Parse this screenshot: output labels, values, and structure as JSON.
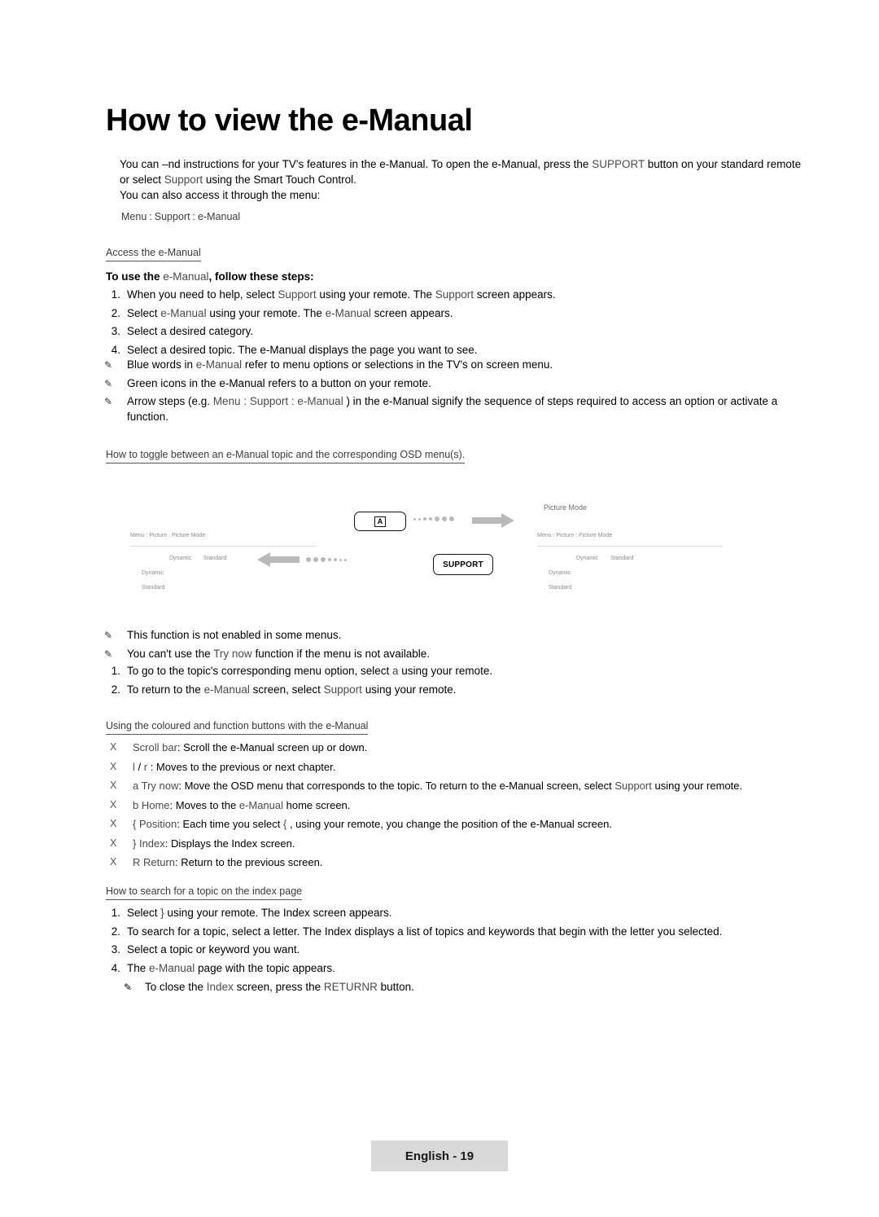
{
  "title": "How to view the e-Manual",
  "intro": {
    "p1_a": "You can ",
    "p1_b": "–nd instructions for your TV's features in the e-Manual. To open the e-Manual, press the ",
    "p1_support": "SUPPORT",
    "p1_c": " button on your standard remote or select ",
    "p1_support2": "Support",
    "p1_d": " using the Smart Touch Control.",
    "p2": "You can also access it through the menu:",
    "menu_path": [
      "Menu",
      "Support",
      "e-Manual"
    ]
  },
  "sections": {
    "access": {
      "heading_a": "Access the",
      "heading_b": "e-Manual",
      "lead_a": "To use the ",
      "lead_b": "e-Manual",
      "lead_c": ", follow these steps:",
      "steps": [
        {
          "num": "1.",
          "parts": [
            {
              "t": "When you need to help, select ",
              "s": "n"
            },
            {
              "t": "Support",
              "s": "l"
            },
            {
              "t": " using your remote. The ",
              "s": "n"
            },
            {
              "t": "Support",
              "s": "l"
            },
            {
              "t": " screen appears.",
              "s": "n"
            }
          ]
        },
        {
          "num": "2.",
          "parts": [
            {
              "t": "Select ",
              "s": "n"
            },
            {
              "t": "e-Manual",
              "s": "l"
            },
            {
              "t": " using your remote. The ",
              "s": "n"
            },
            {
              "t": "e-Manual",
              "s": "l"
            },
            {
              "t": " screen appears.",
              "s": "n"
            }
          ]
        },
        {
          "num": "3.",
          "parts": [
            {
              "t": "Select a desired category.",
              "s": "n"
            }
          ]
        },
        {
          "num": "4.",
          "parts": [
            {
              "t": "Select a desired topic. The e-Manual displays the page you want to see.",
              "s": "n"
            }
          ]
        }
      ],
      "notes": [
        [
          {
            "t": "Blue words in ",
            "s": "n"
          },
          {
            "t": "e-Manual",
            "s": "l"
          },
          {
            "t": " refer to menu options or selections in the TV's on screen menu.",
            "s": "n"
          }
        ],
        [
          {
            "t": "Green icons in the e-Manual refers to a button on your remote.",
            "s": "n"
          }
        ],
        [
          {
            "t": "Arrow steps (e.g. ",
            "s": "n"
          },
          {
            "t": "Menu",
            "s": "l"
          },
          {
            "t": " : ",
            "s": "a"
          },
          {
            "t": "Support",
            "s": "l"
          },
          {
            "t": " : ",
            "s": "a"
          },
          {
            "t": "e-Manual",
            "s": "l"
          },
          {
            "t": " ) in the e-Manual signify the sequence of steps required to access an option or activate a function.",
            "s": "n"
          }
        ]
      ]
    },
    "toggle": {
      "heading": "How to toggle between an e-Manual topic and the corresponding OSD menu(s).",
      "notes": [
        [
          {
            "t": "This function is not enabled in some menus.",
            "s": "n"
          }
        ],
        [
          {
            "t": "You can't use the ",
            "s": "n"
          },
          {
            "t": "Try now",
            "s": "l"
          },
          {
            "t": " function if the menu is not available.",
            "s": "n"
          }
        ]
      ],
      "steps": [
        {
          "num": "1.",
          "parts": [
            {
              "t": "To go to the topic's corresponding menu option, select ",
              "s": "n"
            },
            {
              "t": "a",
              "s": "l"
            },
            {
              "t": " using your remote.",
              "s": "n"
            }
          ]
        },
        {
          "num": "2.",
          "parts": [
            {
              "t": "To return to the ",
              "s": "n"
            },
            {
              "t": "e-Manual",
              "s": "l"
            },
            {
              "t": " screen, select ",
              "s": "n"
            },
            {
              "t": "Support",
              "s": "l"
            },
            {
              "t": " using your remote.",
              "s": "n"
            }
          ]
        }
      ]
    },
    "buttons": {
      "heading": "Using the coloured and function buttons with the e-Manual",
      "items": [
        {
          "bullet": "X",
          "parts": [
            {
              "t": "Scroll bar",
              "s": "l"
            },
            {
              "t": ": Scroll the e-Manual screen up or down.",
              "s": "n"
            }
          ]
        },
        {
          "bullet": "X",
          "parts": [
            {
              "t": "l",
              "s": "l"
            },
            {
              "t": " / ",
              "s": "n"
            },
            {
              "t": "r",
              "s": "l"
            },
            {
              "t": " : Moves to the previous or next chapter.",
              "s": "n"
            }
          ]
        },
        {
          "bullet": "X",
          "parts": [
            {
              "t": "a",
              "s": "l"
            },
            {
              "t": " ",
              "s": "n"
            },
            {
              "t": "Try now",
              "s": "l"
            },
            {
              "t": ": Move the OSD menu that corresponds to the topic. To return to the e-Manual screen, select ",
              "s": "n"
            },
            {
              "t": "Support",
              "s": "l"
            },
            {
              "t": " using your remote.",
              "s": "n"
            }
          ]
        },
        {
          "bullet": "X",
          "parts": [
            {
              "t": "b",
              "s": "l"
            },
            {
              "t": " ",
              "s": "n"
            },
            {
              "t": "Home",
              "s": "l"
            },
            {
              "t": ": Moves to the ",
              "s": "n"
            },
            {
              "t": "e-Manual",
              "s": "l"
            },
            {
              "t": " home screen.",
              "s": "n"
            }
          ]
        },
        {
          "bullet": "X",
          "parts": [
            {
              "t": "{",
              "s": "l"
            },
            {
              "t": " ",
              "s": "n"
            },
            {
              "t": "Position",
              "s": "l"
            },
            {
              "t": ": Each time you select ",
              "s": "n"
            },
            {
              "t": "{",
              "s": "l"
            },
            {
              "t": " , using your remote, you change the position of the e-Manual screen.",
              "s": "n"
            }
          ]
        },
        {
          "bullet": "X",
          "parts": [
            {
              "t": "}",
              "s": "l"
            },
            {
              "t": " ",
              "s": "n"
            },
            {
              "t": "Index",
              "s": "l"
            },
            {
              "t": ": Displays the Index screen.",
              "s": "n"
            }
          ]
        },
        {
          "bullet": "X",
          "parts": [
            {
              "t": "R",
              "s": "l"
            },
            {
              "t": " ",
              "s": "n"
            },
            {
              "t": "Return",
              "s": "l"
            },
            {
              "t": ": Return to the previous screen.",
              "s": "n"
            }
          ]
        }
      ]
    },
    "search": {
      "heading": "How to search for a topic on the index page",
      "steps": [
        {
          "num": "1.",
          "parts": [
            {
              "t": "Select ",
              "s": "n"
            },
            {
              "t": "}",
              "s": "l"
            },
            {
              "t": " using your remote. The Index screen appears.",
              "s": "n"
            }
          ]
        },
        {
          "num": "2.",
          "parts": [
            {
              "t": "To search for a topic, select a letter. The Index displays a list of topics and keywords that begin with the letter you selected.",
              "s": "n"
            }
          ]
        },
        {
          "num": "3.",
          "parts": [
            {
              "t": "Select a topic or keyword you want.",
              "s": "n"
            }
          ]
        },
        {
          "num": "4.",
          "parts": [
            {
              "t": "The ",
              "s": "n"
            },
            {
              "t": "e-Manual",
              "s": "l"
            },
            {
              "t": " page with the topic appears.",
              "s": "n"
            }
          ]
        }
      ],
      "sub_note": [
        {
          "t": "To close the ",
          "s": "n"
        },
        {
          "t": "Index",
          "s": "l"
        },
        {
          "t": " screen, press the ",
          "s": "n"
        },
        {
          "t": "RETURN",
          "s": "l"
        },
        {
          "t": "R",
          "s": "l"
        },
        {
          "t": " button.",
          "s": "n"
        }
      ]
    }
  },
  "diagram": {
    "chip_a_label": "A",
    "chip_support_label": "SUPPORT",
    "picture_mode_label": "Picture Mode",
    "osd_left": {
      "breadcrumb": "Menu : Picture : Picture Mode",
      "rows": [
        "Dynamic",
        "Standard",
        "Dynamic",
        "Standard"
      ]
    },
    "osd_right": {
      "breadcrumb": "Menu : Picture : Picture Mode",
      "rows": [
        "Dynamic",
        "Standard",
        "Dynamic",
        "Standard"
      ]
    }
  },
  "footer": {
    "label": "English - 19"
  }
}
